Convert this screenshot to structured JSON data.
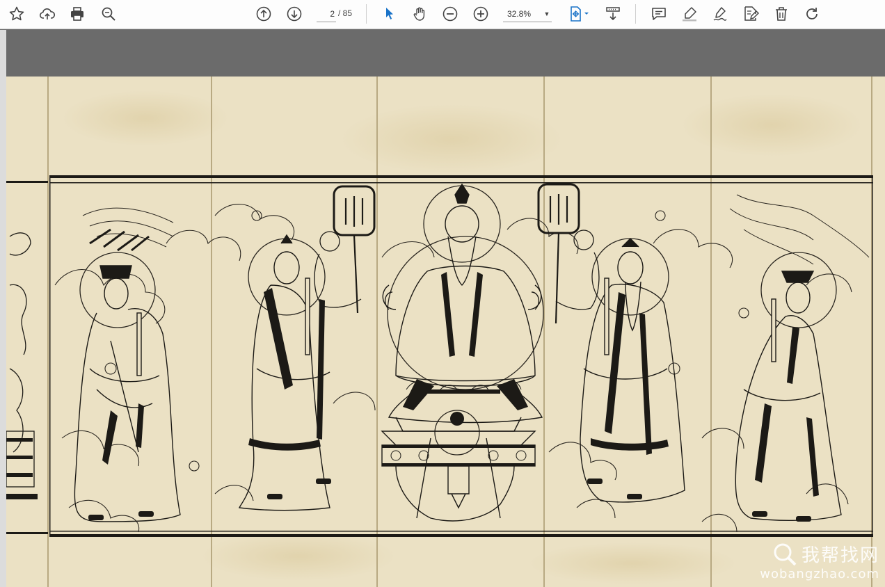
{
  "toolbar": {
    "page_current": "2",
    "page_total": "/ 85",
    "zoom": "32.8%",
    "icons": {
      "bookmark": "star-icon",
      "upload": "cloud-upload-icon",
      "print": "printer-icon",
      "find": "magnifier-icon",
      "prev_page": "arrow-up-circle-icon",
      "next_page": "arrow-down-circle-icon",
      "select": "cursor-icon",
      "hand": "hand-icon",
      "zoom_out": "minus-circle-icon",
      "zoom_in": "plus-circle-icon",
      "fit": "fit-page-icon",
      "read_mode": "read-mode-icon",
      "comment": "comment-icon",
      "highlight": "highlighter-icon",
      "sign": "sign-icon",
      "edit": "edit-doc-icon",
      "delete": "trash-icon",
      "rotate": "rotate-icon"
    },
    "accent_color": "#1a73c8"
  },
  "watermark": {
    "cn": "我帮找网",
    "en": "wobangzhao.com"
  }
}
